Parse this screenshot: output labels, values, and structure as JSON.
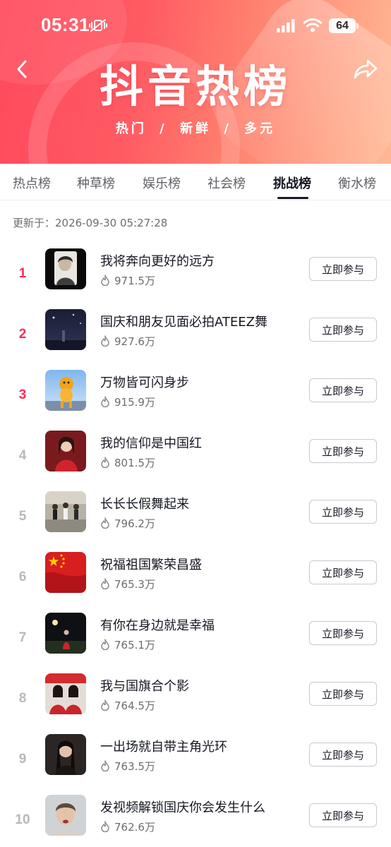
{
  "status_bar": {
    "time": "05:31",
    "battery": "64"
  },
  "banner": {
    "title": "抖音热榜",
    "subtitle": "热门 / 新鲜 / 多元"
  },
  "tabs": [
    {
      "label": "热点榜"
    },
    {
      "label": "种草榜"
    },
    {
      "label": "娱乐榜"
    },
    {
      "label": "社会榜"
    },
    {
      "label": "挑战榜",
      "active": true
    },
    {
      "label": "衡水榜"
    }
  ],
  "updated_text": "更新于：2026-09-30 05:27:28",
  "join_label": "立即参与",
  "items": [
    {
      "rank": "1",
      "title": "我将奔向更好的远方",
      "heat": "971.5万"
    },
    {
      "rank": "2",
      "title": "国庆和朋友见面必拍ATEEZ舞",
      "heat": "927.6万"
    },
    {
      "rank": "3",
      "title": "万物皆可闪身步",
      "heat": "915.9万"
    },
    {
      "rank": "4",
      "title": "我的信仰是中国红",
      "heat": "801.5万"
    },
    {
      "rank": "5",
      "title": "长长长假舞起来",
      "heat": "796.2万"
    },
    {
      "rank": "6",
      "title": "祝福祖国繁荣昌盛",
      "heat": "765.3万"
    },
    {
      "rank": "7",
      "title": "有你在身边就是幸福",
      "heat": "765.1万"
    },
    {
      "rank": "8",
      "title": "我与国旗合个影",
      "heat": "764.5万"
    },
    {
      "rank": "9",
      "title": "一出场就自带主角光环",
      "heat": "763.5万"
    },
    {
      "rank": "10",
      "title": "发视频解锁国庆你会发生什么",
      "heat": "762.6万"
    }
  ],
  "colors": {
    "accent": "#fe2c55",
    "banner_start": "#ff4a5c",
    "banner_end": "#ffb894",
    "rank_gray": "#b8b8bd"
  }
}
